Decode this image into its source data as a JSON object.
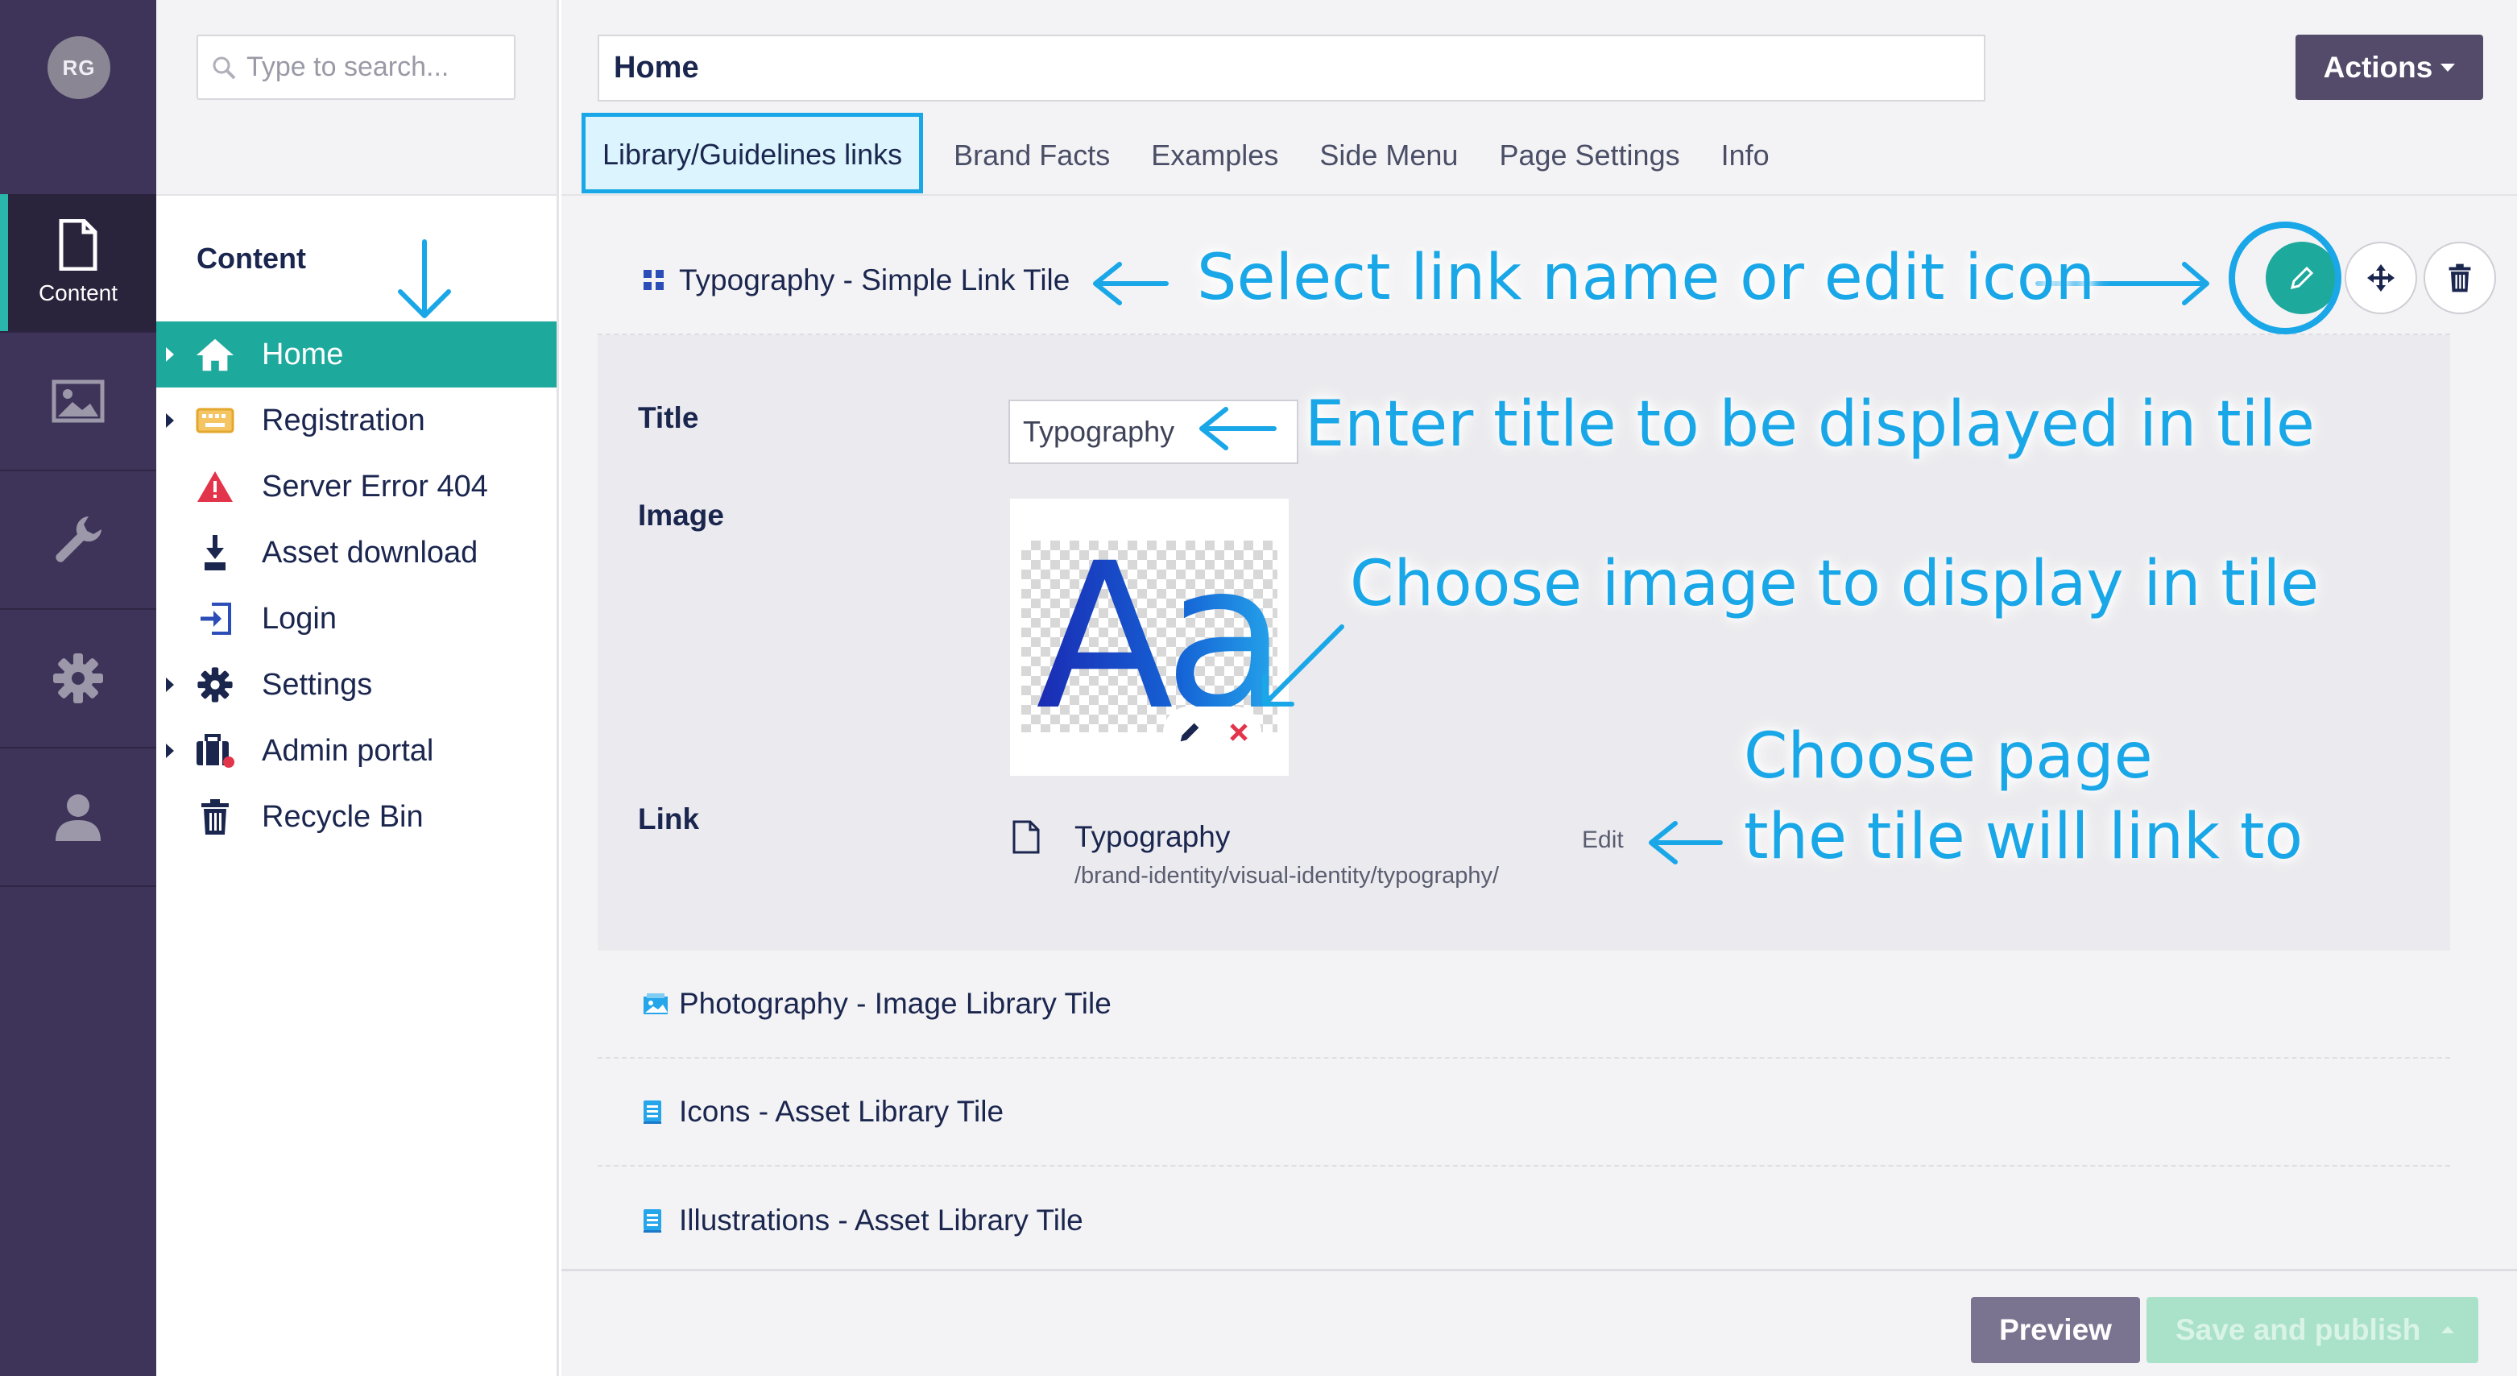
{
  "user": {
    "initials": "RG"
  },
  "rail": {
    "items": [
      {
        "label": "Content",
        "icon": "document-icon"
      },
      {
        "label": "",
        "icon": "image-icon"
      },
      {
        "label": "",
        "icon": "wrench-icon"
      },
      {
        "label": "",
        "icon": "gear-icon"
      },
      {
        "label": "",
        "icon": "user-icon"
      }
    ]
  },
  "search": {
    "placeholder": "Type to search..."
  },
  "tree": {
    "title": "Content",
    "items": [
      {
        "label": "Home",
        "icon": "home-icon",
        "expandable": true,
        "active": true
      },
      {
        "label": "Registration",
        "icon": "keyboard-icon",
        "expandable": true
      },
      {
        "label": "Server Error 404",
        "icon": "warning-icon",
        "expandable": false
      },
      {
        "label": "Asset download",
        "icon": "download-icon",
        "expandable": false
      },
      {
        "label": "Login",
        "icon": "login-icon",
        "expandable": false
      },
      {
        "label": "Settings",
        "icon": "gear-icon",
        "expandable": true
      },
      {
        "label": "Admin portal",
        "icon": "briefcase-icon",
        "expandable": true
      },
      {
        "label": "Recycle Bin",
        "icon": "trash-icon",
        "expandable": false
      }
    ]
  },
  "editor": {
    "name": "Home",
    "actions_label": "Actions",
    "tabs": [
      "Library/Guidelines links",
      "Brand Facts",
      "Examples",
      "Side Menu",
      "Page Settings",
      "Info"
    ],
    "blocks": [
      {
        "label": "Typography - Simple Link Tile",
        "icon": "grid-icon",
        "expanded": true
      },
      {
        "label": "Photography - Image Library Tile",
        "icon": "image-tile-icon"
      },
      {
        "label": "Icons - Asset Library Tile",
        "icon": "asset-tile-icon"
      },
      {
        "label": "Illustrations - Asset Library Tile",
        "icon": "asset-tile-icon"
      }
    ],
    "props": {
      "title_label": "Title",
      "title_value": "Typography",
      "image_label": "Image",
      "image_glyph": "Aa",
      "link_label": "Link",
      "link_name": "Typography",
      "link_url": "/brand-identity/visual-identity/typography/",
      "link_edit": "Edit"
    },
    "preview_label": "Preview",
    "publish_label": "Save and publish"
  },
  "annotations": {
    "select": "Select link name or edit icon",
    "title": "Enter title to be displayed in tile",
    "image": "Choose image to display in tile",
    "page_line1": "Choose page",
    "page_line2": "the tile will link to"
  },
  "colors": {
    "rail": "#3e3459",
    "teal": "#1ea99d",
    "annotation": "#19a7e8"
  }
}
